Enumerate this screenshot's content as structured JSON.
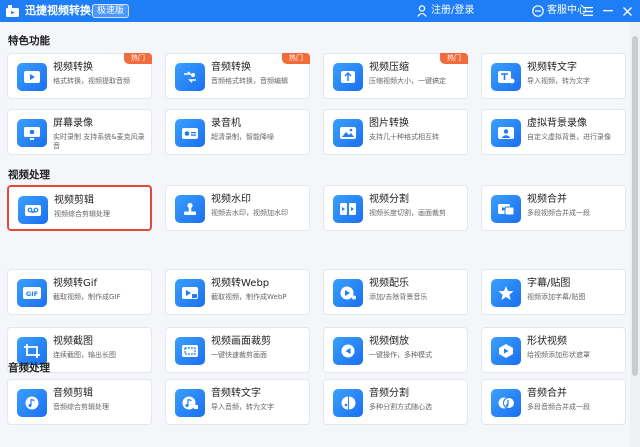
{
  "app": {
    "title": "迅捷视频转换器",
    "edition": "极速版"
  },
  "header": {
    "login_label": "注册/登录",
    "service_label": "客服中心"
  },
  "sections": [
    {
      "title": "特色功能",
      "cards": [
        {
          "title": "视频转换",
          "desc": "格式转换，视频提取音频",
          "icon": "video-convert-icon",
          "badge": "热门"
        },
        {
          "title": "音频转换",
          "desc": "音频格式转换，音频编辑",
          "icon": "audio-convert-icon",
          "badge": "热门"
        },
        {
          "title": "视频压缩",
          "desc": "压缩视频大小，一键搞定",
          "icon": "video-compress-icon",
          "badge": "热门"
        },
        {
          "title": "视频转文字",
          "desc": "导入视频，转为文字",
          "icon": "video-to-text-icon"
        },
        {
          "title": "屏幕录像",
          "desc": "实时录制 支持系统&麦克风录音",
          "icon": "screen-record-icon"
        },
        {
          "title": "录音机",
          "desc": "超清录制，智能降噪",
          "icon": "recorder-icon"
        },
        {
          "title": "图片转换",
          "desc": "支持几十种格式相互转",
          "icon": "image-convert-icon"
        },
        {
          "title": "虚拟背景录像",
          "desc": "自定义虚拟背景，进行录像",
          "icon": "virtual-background-icon"
        }
      ]
    },
    {
      "title": "视频处理",
      "cards": [
        {
          "title": "视频剪辑",
          "desc": "视频综合剪辑处理",
          "icon": "video-edit-icon",
          "selected": true
        },
        {
          "title": "视频水印",
          "desc": "视频去水印，视频加水印",
          "icon": "watermark-icon"
        },
        {
          "title": "视频分割",
          "desc": "视频长度切割，画面裁剪",
          "icon": "video-split-icon"
        },
        {
          "title": "视频合并",
          "desc": "多段视频合并成一段",
          "icon": "video-merge-icon"
        },
        {
          "title": "视频转Gif",
          "desc": "截取视频，制作成GIF",
          "icon": "gif-icon"
        },
        {
          "title": "视频转Webp",
          "desc": "截取视频，制作成WebP",
          "icon": "webp-icon"
        },
        {
          "title": "视频配乐",
          "desc": "添加/去除背景音乐",
          "icon": "video-music-icon"
        },
        {
          "title": "字幕/贴图",
          "desc": "视频添加字幕/贴图",
          "icon": "subtitle-icon"
        },
        {
          "title": "视频截图",
          "desc": "连续截图，输出长图",
          "icon": "screenshot-icon"
        },
        {
          "title": "视频画面裁剪",
          "desc": "一键快速裁剪画面",
          "icon": "crop-icon"
        },
        {
          "title": "视频倒放",
          "desc": "一键操作，多种模式",
          "icon": "reverse-icon"
        },
        {
          "title": "形状视频",
          "desc": "给视频添加形状遮罩",
          "icon": "shape-video-icon"
        }
      ]
    },
    {
      "title": "音频处理",
      "cards": [
        {
          "title": "音频剪辑",
          "desc": "音频综合剪辑处理",
          "icon": "audio-edit-icon"
        },
        {
          "title": "音频转文字",
          "desc": "导入音频，转为文字",
          "icon": "audio-to-text-icon"
        },
        {
          "title": "音频分割",
          "desc": "多种分割方式随心选",
          "icon": "audio-split-icon"
        },
        {
          "title": "音频合并",
          "desc": "多段音频合并成一段",
          "icon": "audio-merge-icon"
        }
      ]
    }
  ]
}
